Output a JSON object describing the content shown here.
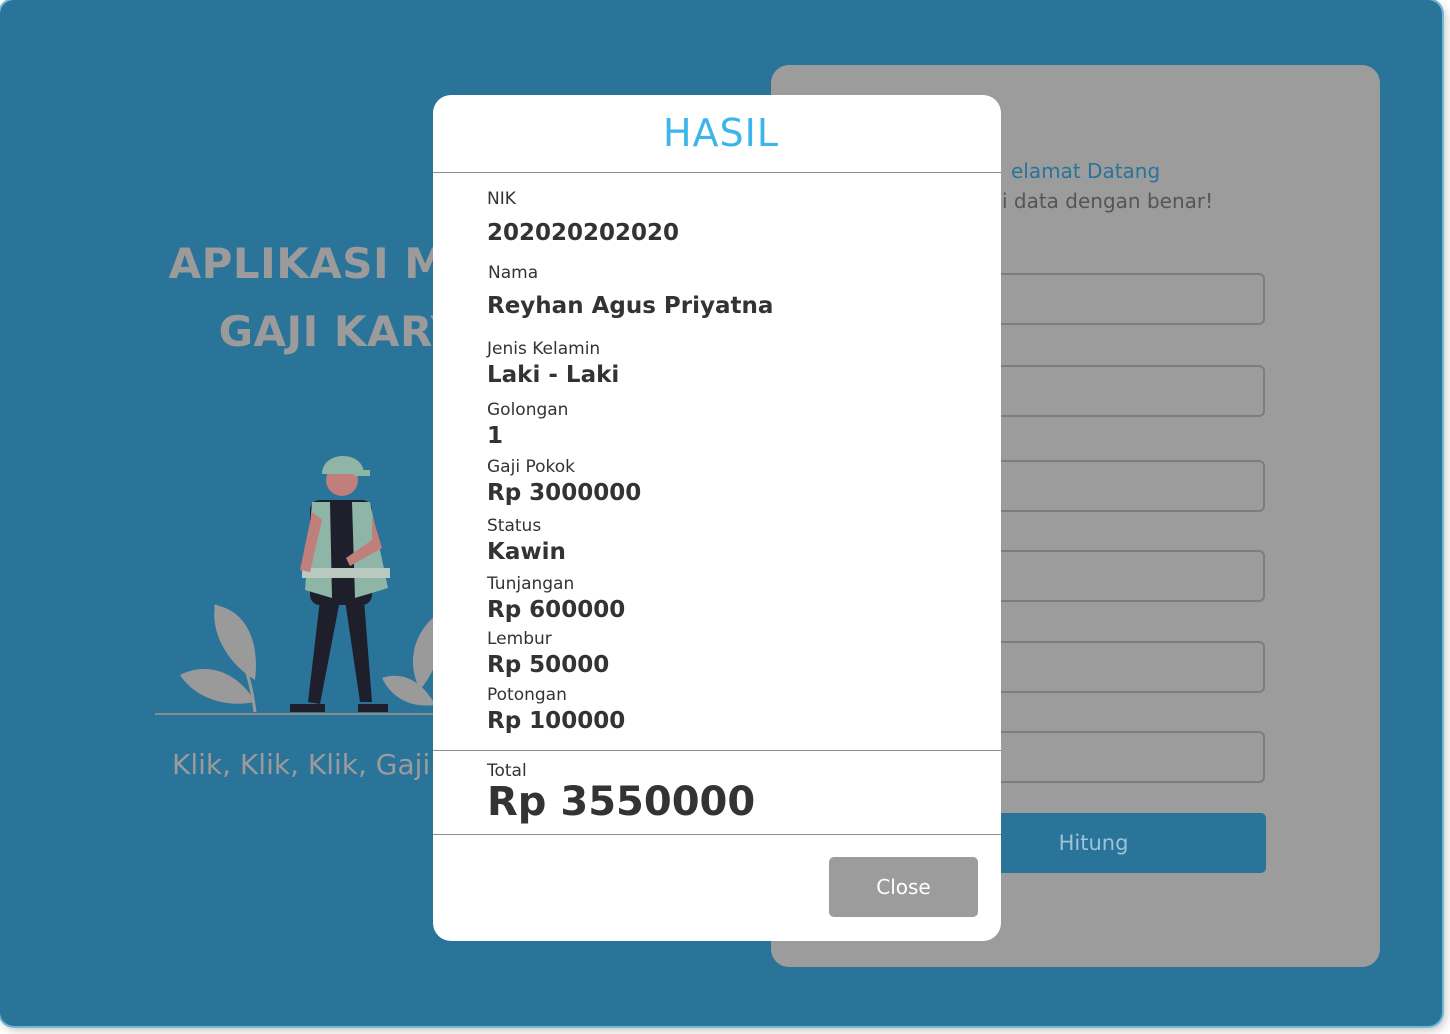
{
  "hero": {
    "title_line1": "APLIKASI MEN",
    "title_line2": "GAJI KARY",
    "tagline": "Klik, Klik, Klik, Gaji s"
  },
  "form": {
    "greeting": "elamat Datang",
    "subtitle": "isi data dengan benar!",
    "submit_label": "Hitung"
  },
  "modal": {
    "title": "HASIL",
    "fields": [
      {
        "label": "NIK",
        "value": "202020202020"
      },
      {
        "label": "Nama",
        "value": "Reyhan Agus Priyatna"
      },
      {
        "label": "Jenis Kelamin",
        "value": "Laki - Laki"
      },
      {
        "label": "Golongan",
        "value": "1"
      },
      {
        "label": "Gaji Pokok",
        "value": "Rp 3000000"
      },
      {
        "label": "Status",
        "value": "Kawin"
      },
      {
        "label": "Tunjangan",
        "value": "Rp 600000"
      },
      {
        "label": "Lembur",
        "value": "Rp 50000"
      },
      {
        "label": "Potongan",
        "value": "Rp 100000"
      }
    ],
    "total_label": "Total",
    "total_value": "Rp 3550000",
    "close_label": "Close"
  },
  "colors": {
    "background": "#2a7399",
    "accent": "#3cb6ea",
    "card": "#9c9c9c"
  }
}
